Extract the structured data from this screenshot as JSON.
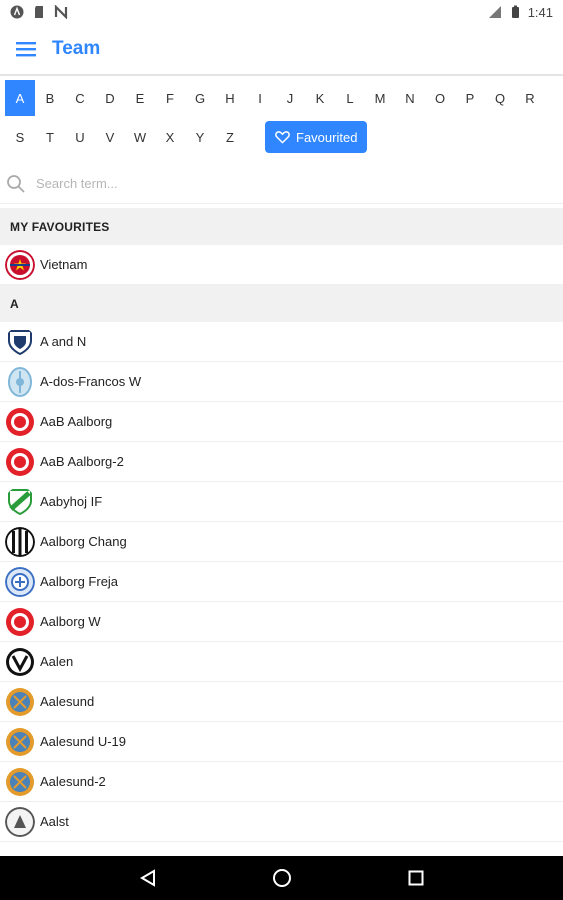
{
  "status_bar": {
    "time": "1:41",
    "left_icons": [
      "android-icon",
      "sd-card-icon",
      "n-icon"
    ],
    "right_icons": [
      "signal-icon",
      "battery-icon"
    ]
  },
  "app_bar": {
    "title": "Team",
    "menu_icon": "hamburger-menu-icon"
  },
  "alphabet": {
    "row1": [
      "A",
      "B",
      "C",
      "D",
      "E",
      "F",
      "G",
      "H",
      "I",
      "J",
      "K",
      "L",
      "M",
      "N",
      "O",
      "P",
      "Q",
      "R"
    ],
    "row2": [
      "S",
      "T",
      "U",
      "V",
      "W",
      "X",
      "Y",
      "Z"
    ],
    "selected": "A",
    "favourited_label": "Favourited"
  },
  "search": {
    "placeholder": "Search term...",
    "value": ""
  },
  "sections": [
    {
      "header": "MY FAVOURITES",
      "teams": [
        {
          "name": "Vietnam",
          "crest": "vietnam-crest-icon",
          "color": "#c8102e"
        }
      ]
    },
    {
      "header": "A",
      "teams": [
        {
          "name": "A and N",
          "crest": "a-and-n-crest-icon",
          "color": "#1f3b6e"
        },
        {
          "name": "A-dos-Francos W",
          "crest": "a-dos-francos-crest-icon",
          "color": "#7fb6d9"
        },
        {
          "name": "AaB Aalborg",
          "crest": "aab-crest-icon",
          "color": "#e32129"
        },
        {
          "name": "AaB Aalborg-2",
          "crest": "aab-crest-icon",
          "color": "#e32129"
        },
        {
          "name": "Aabyhoj IF",
          "crest": "aabyhoj-crest-icon",
          "color": "#2a9d3a"
        },
        {
          "name": "Aalborg Chang",
          "crest": "aalborg-chang-crest-icon",
          "color": "#111111"
        },
        {
          "name": "Aalborg Freja",
          "crest": "aalborg-freja-crest-icon",
          "color": "#3a6fc4"
        },
        {
          "name": "Aalborg W",
          "crest": "aab-crest-icon",
          "color": "#e32129"
        },
        {
          "name": "Aalen",
          "crest": "aalen-crest-icon",
          "color": "#111111"
        },
        {
          "name": "Aalesund",
          "crest": "aalesund-crest-icon",
          "color": "#e39b2b"
        },
        {
          "name": "Aalesund U-19",
          "crest": "aalesund-crest-icon",
          "color": "#e39b2b"
        },
        {
          "name": "Aalesund-2",
          "crest": "aalesund-crest-icon",
          "color": "#e39b2b"
        },
        {
          "name": "Aalst",
          "crest": "aalst-crest-icon",
          "color": "#555555"
        }
      ]
    }
  ],
  "nav_bar": {
    "buttons": [
      "back-icon",
      "home-icon",
      "recents-icon"
    ]
  },
  "colors": {
    "accent": "#2f86ff",
    "section_bg": "#f1f1f1"
  }
}
